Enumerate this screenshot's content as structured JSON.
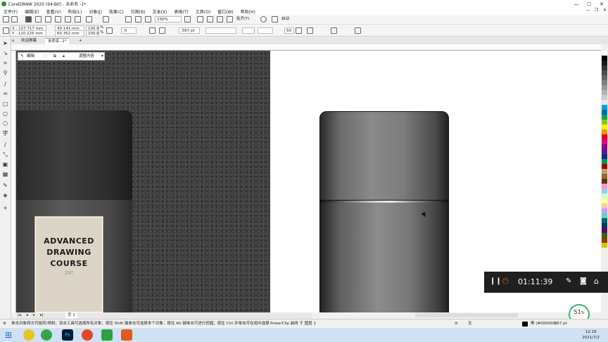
{
  "window": {
    "title": "CorelDRAW 2020 (64-Bit) - 未命名 -1*"
  },
  "menu": [
    "文件(F)",
    "编辑(E)",
    "查看(V)",
    "布局(L)",
    "对象(J)",
    "效果(C)",
    "位图(B)",
    "文本(X)",
    "表格(T)",
    "工具(O)",
    "窗口(W)",
    "帮助(H)"
  ],
  "toolbar": {
    "zoom": "230%",
    "snap_label": "贴齐(T)",
    "launch_label": "启动"
  },
  "props": {
    "x": "X : 127.717 mm",
    "y": "Y : 110.225 mm",
    "w": "43.141 mm",
    "h": "60.352 mm",
    "sx": "100.0",
    "sy": "100.0",
    "pct": "%",
    "angle": ".0",
    "outline": ".567 pt",
    "corner": "50"
  },
  "tabs": {
    "welcome": "欢迎屏幕",
    "doc": "未命名 -1*"
  },
  "float_toolbar": {
    "edit": "编辑",
    "adjust": "调整内容"
  },
  "label": {
    "lines": [
      "ADVANCED",
      "DRAWING",
      "COURSE"
    ],
    "brand": "ZXT"
  },
  "recorder": {
    "time": "01:11:39"
  },
  "progress": {
    "value": "51",
    "unit": "%",
    "rate": "0K/s"
  },
  "page": {
    "name": "页 1"
  },
  "status": {
    "hint": "单击对象两次可旋转/倾斜；双击工具可选择所有对象；按住 Shift 键单击可选择多个对象；按住 Alt 键单击可进行挖掘；按住 Ctrl 并单击可在组中选择",
    "object": "PowerClip 曲线 于 图层 1",
    "fill": "无",
    "outline_color": "黑 (#000000)",
    "outline_width": ".567 pt"
  },
  "clock": {
    "time": "12:18",
    "date": "2021/7/2"
  },
  "palette": [
    "#ffffff",
    "#000000",
    "#1a1a1a",
    "#333333",
    "#4d4d4d",
    "#666666",
    "#808080",
    "#999999",
    "#b3b3b3",
    "#cccccc",
    "#e6e6e6",
    "#00a0e9",
    "#0068b7",
    "#00a650",
    "#8fc31f",
    "#fff100",
    "#f39800",
    "#e60012",
    "#e4007f",
    "#920783",
    "#601986",
    "#1d2088",
    "#009944",
    "#a40000",
    "#c49a6c",
    "#996633",
    "#663300",
    "#ff99cc",
    "#99ccff",
    "#ccffcc",
    "#ffff99",
    "#ffcc99",
    "#cc99ff",
    "#66cccc",
    "#006666",
    "#003366",
    "#660066",
    "#336600",
    "#993300",
    "#cccc00"
  ]
}
